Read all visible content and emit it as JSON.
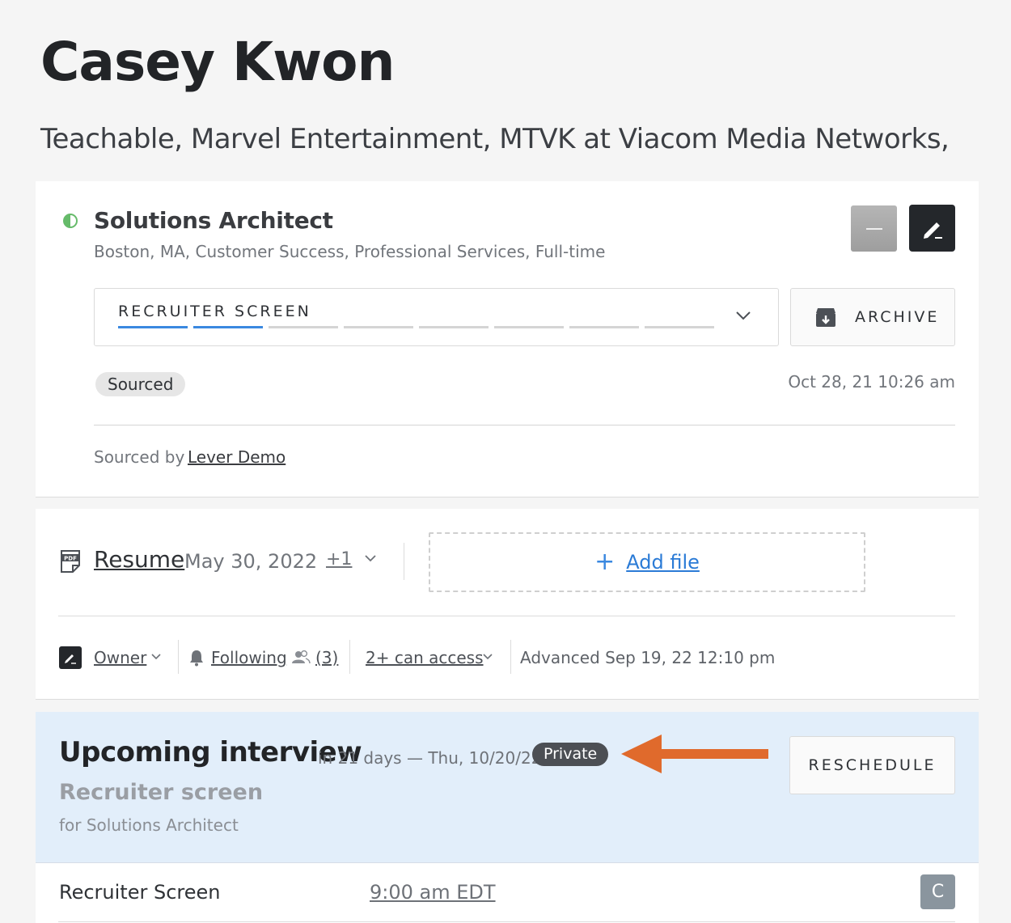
{
  "candidate": {
    "name": "Casey Kwon",
    "companies": "Teachable, Marvel Entertainment, MTVK at Viacom Media Networks,"
  },
  "opportunity": {
    "status_color": "#66bb6a",
    "posting_title": "Solutions Architect",
    "posting_meta": "Boston, MA, Customer Success, Professional Services, Full-time",
    "stage": {
      "label": "RECRUITER SCREEN",
      "total_steps": 8,
      "completed_steps": 2,
      "accent": "#3a88e0"
    },
    "archive_label": "ARCHIVE",
    "origin_badge": "Sourced",
    "created": "Oct 28, 21 10:26 am",
    "sourced_by_label": "Sourced by",
    "sourced_by_name": "Lever Demo",
    "minus_icon": "minus-icon",
    "edit_icon": "pencil-icon"
  },
  "files": {
    "resume_label": "Resume",
    "resume_date": "May 30, 2022",
    "more_count": "+1",
    "add_file_label": "Add file"
  },
  "meta": {
    "owner_label": "Owner",
    "following_label": "Following",
    "followers_count": "(3)",
    "access_label": "2+ can access",
    "advanced_text": "Advanced Sep 19, 22 12:10 pm"
  },
  "interview": {
    "title": "Upcoming interview",
    "when": "in 21 days — Thu, 10/20/22",
    "private_badge": "Private",
    "type": "Recruiter screen",
    "for_posting": "for Solutions Architect",
    "reschedule_label": "RESCHEDULE",
    "background_color": "#e2eefa",
    "annotation_arrow_color": "#e06a2c"
  },
  "slot": {
    "name": "Recruiter Screen",
    "time": "9:00 am EDT",
    "avatar_initial": "C"
  }
}
